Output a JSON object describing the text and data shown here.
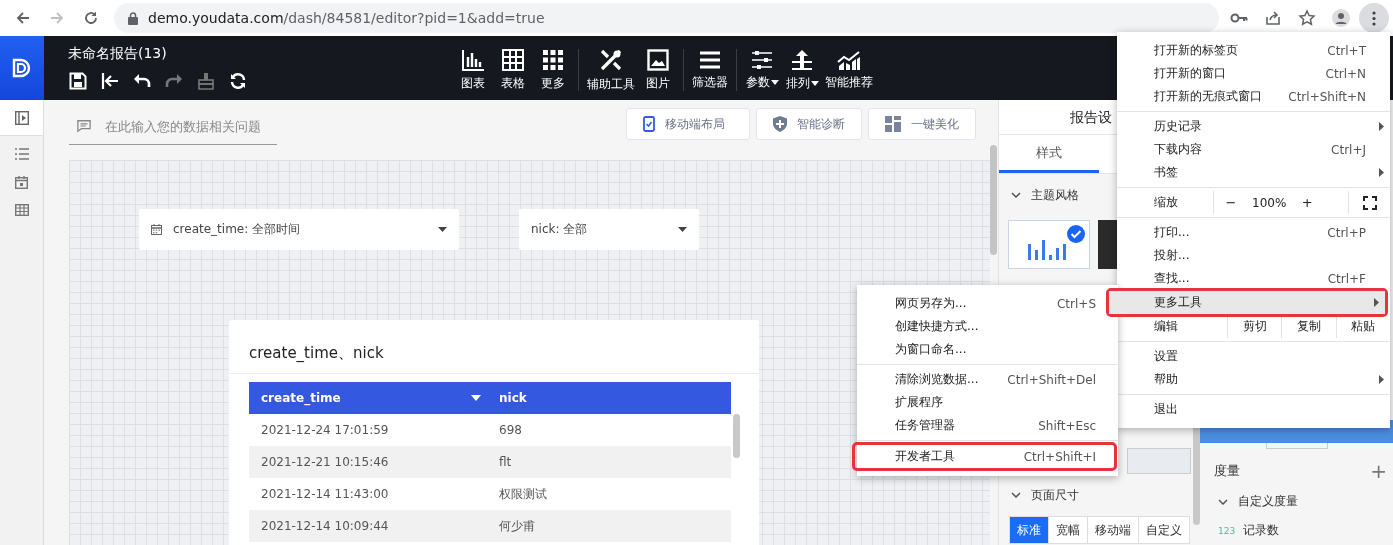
{
  "browser": {
    "nav": [
      {
        "kind": "back",
        "disabled": false
      },
      {
        "kind": "forward",
        "disabled": true
      },
      {
        "kind": "reload",
        "disabled": false
      }
    ],
    "url_host": "demo.youdata.com",
    "url_path": "/dash/84581/editor?pid=1&add=true",
    "toolbar": [
      {
        "kind": "key",
        "active": false
      },
      {
        "kind": "share",
        "active": false
      },
      {
        "kind": "star",
        "active": false
      },
      {
        "kind": "profile",
        "active": false
      },
      {
        "kind": "kebab",
        "active": true
      }
    ]
  },
  "app": {
    "title": "未命名报告(13)",
    "quick_tools": [
      {
        "kind": "save",
        "disabled": false
      },
      {
        "kind": "exit",
        "disabled": false
      },
      {
        "kind": "undo",
        "disabled": false
      },
      {
        "kind": "redo",
        "disabled": true
      },
      {
        "kind": "brush",
        "disabled": true
      },
      {
        "kind": "refresh",
        "disabled": false
      }
    ],
    "tool_groups": [
      [
        {
          "kind": "chart",
          "label": "图表",
          "dropdown": false
        },
        {
          "kind": "table",
          "label": "表格",
          "dropdown": false
        },
        {
          "kind": "more",
          "label": "更多",
          "dropdown": false
        }
      ],
      [
        {
          "kind": "tools",
          "label": "辅助工具",
          "dropdown": false
        },
        {
          "kind": "image",
          "label": "图片",
          "dropdown": false
        }
      ],
      [
        {
          "kind": "filter",
          "label": "筛选器",
          "dropdown": false
        }
      ],
      [
        {
          "kind": "param",
          "label": "参数",
          "dropdown": true
        },
        {
          "kind": "sort",
          "label": "排列",
          "dropdown": true
        },
        {
          "kind": "recommend",
          "label": "智能推荐",
          "dropdown": false
        }
      ]
    ]
  },
  "sidebar": {
    "items": [
      {
        "kind": "collapse",
        "selected": true
      },
      {
        "kind": "list",
        "selected": false
      },
      {
        "kind": "calendar",
        "selected": false
      },
      {
        "kind": "table",
        "selected": false
      }
    ]
  },
  "question": {
    "placeholder": "在此输入您的数据相关问题"
  },
  "actions": [
    {
      "kind": "mobile",
      "label": "移动端布局"
    },
    {
      "kind": "diagnose",
      "label": "智能诊断"
    },
    {
      "kind": "beautify",
      "label": "一键美化"
    }
  ],
  "filters": [
    {
      "kind": "date",
      "label": "create_time: 全部时间"
    },
    {
      "kind": "select",
      "label": "nick: 全部"
    }
  ],
  "table": {
    "title": "create_time、nick",
    "columns": [
      {
        "label": "create_time",
        "sorted": true
      },
      {
        "label": "nick",
        "sorted": false
      }
    ],
    "rows": [
      [
        "2021-12-24 17:01:59",
        "698"
      ],
      [
        "2021-12-21 10:15:46",
        "flt"
      ],
      [
        "2021-12-14 11:43:00",
        "权限测试"
      ],
      [
        "2021-12-14 10:09:44",
        "何少甫"
      ]
    ]
  },
  "settings": {
    "title": "报告设",
    "tabs": [
      {
        "label": "样式",
        "selected": true
      }
    ],
    "theme": {
      "title": "主题风格",
      "expanded": true,
      "themes": [
        {
          "kind": "light",
          "selected": true
        },
        {
          "kind": "dark",
          "selected": false
        }
      ]
    },
    "page_size": {
      "title": "页面尺寸",
      "expanded": true,
      "options": [
        {
          "label": "标准",
          "selected": true
        },
        {
          "label": "宽幅",
          "selected": false
        },
        {
          "label": "移动端",
          "selected": false
        },
        {
          "label": "自定义",
          "selected": false
        }
      ]
    }
  },
  "fields": {
    "measure_title": "度量",
    "add": "+",
    "groups": [
      {
        "label": "自定义度量",
        "expanded": true,
        "children": [
          {
            "type": "123",
            "label": "记录数"
          }
        ]
      }
    ]
  },
  "chrome_menu": {
    "sections": [
      {
        "items": [
          {
            "kind": "item",
            "label": "打开新的标签页",
            "shortcut": "Ctrl+T",
            "submenu": false,
            "highlighted": false,
            "outlined": false
          },
          {
            "kind": "item",
            "label": "打开新的窗口",
            "shortcut": "Ctrl+N",
            "submenu": false,
            "highlighted": false,
            "outlined": false
          },
          {
            "kind": "item",
            "label": "打开新的无痕式窗口",
            "shortcut": "Ctrl+Shift+N",
            "submenu": false,
            "highlighted": false,
            "outlined": false
          }
        ]
      },
      {
        "items": [
          {
            "kind": "item",
            "label": "历史记录",
            "submenu": true,
            "highlighted": false,
            "outlined": false
          },
          {
            "kind": "item",
            "label": "下载内容",
            "shortcut": "Ctrl+J",
            "submenu": false,
            "highlighted": false,
            "outlined": false
          },
          {
            "kind": "item",
            "label": "书签",
            "submenu": true,
            "highlighted": false,
            "outlined": false
          }
        ]
      },
      {
        "items": [
          {
            "kind": "zoom",
            "label": "缩放",
            "minus": "−",
            "value": "100%",
            "plus": "+"
          }
        ]
      },
      {
        "items": [
          {
            "kind": "item",
            "label": "打印...",
            "shortcut": "Ctrl+P",
            "submenu": false,
            "highlighted": false,
            "outlined": false
          },
          {
            "kind": "item",
            "label": "投射...",
            "submenu": false,
            "highlighted": false,
            "outlined": false
          },
          {
            "kind": "item",
            "label": "查找...",
            "shortcut": "Ctrl+F",
            "submenu": false,
            "highlighted": false,
            "outlined": false
          },
          {
            "kind": "item",
            "label": "更多工具",
            "submenu": true,
            "highlighted": true,
            "outlined": true
          },
          {
            "kind": "edit",
            "label": "编辑",
            "actions": [
              "剪切",
              "复制",
              "粘贴"
            ]
          }
        ]
      },
      {
        "items": [
          {
            "kind": "item",
            "label": "设置",
            "submenu": false,
            "highlighted": false,
            "outlined": false
          },
          {
            "kind": "item",
            "label": "帮助",
            "submenu": true,
            "highlighted": false,
            "outlined": false
          }
        ]
      },
      {
        "items": [
          {
            "kind": "item",
            "label": "退出",
            "submenu": false,
            "highlighted": false,
            "outlined": false
          }
        ]
      }
    ]
  },
  "more_tools_menu": {
    "sections": [
      {
        "items": [
          {
            "label": "网页另存为...",
            "shortcut": "Ctrl+S",
            "outlined": false
          },
          {
            "label": "创建快捷方式...",
            "outlined": false
          },
          {
            "label": "为窗口命名...",
            "outlined": false
          }
        ]
      },
      {
        "items": [
          {
            "label": "清除浏览数据...",
            "shortcut": "Ctrl+Shift+Del",
            "outlined": false
          },
          {
            "label": "扩展程序",
            "outlined": false
          },
          {
            "label": "任务管理器",
            "shortcut": "Shift+Esc",
            "outlined": false
          }
        ]
      },
      {
        "items": [
          {
            "label": "开发者工具",
            "shortcut": "Ctrl+Shift+I",
            "outlined": true
          }
        ]
      }
    ]
  }
}
